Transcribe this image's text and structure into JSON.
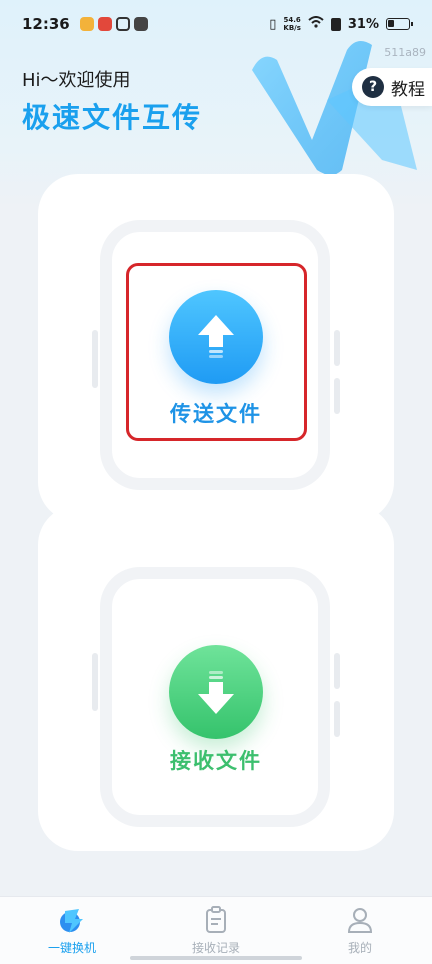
{
  "status_bar": {
    "time": "12:36",
    "net_speed_value": "54.6",
    "net_speed_unit": "KB/s",
    "battery": "31%"
  },
  "version": "511a89",
  "header": {
    "greeting": "Hi～欢迎使用",
    "title": "极速文件互传",
    "tutorial_label": "教程"
  },
  "cards": {
    "send_label": "传送文件",
    "receive_label": "接收文件"
  },
  "bottom_nav": {
    "items": [
      {
        "label": "一键换机",
        "icon": "switch-phone-icon",
        "active": true
      },
      {
        "label": "接收记录",
        "icon": "clipboard-icon",
        "active": false
      },
      {
        "label": "我的",
        "icon": "person-icon",
        "active": false
      }
    ]
  },
  "colors": {
    "accent": "#1aa0ee",
    "send": "#1f9bf4",
    "receive": "#35c36c",
    "highlight": "#d6262a"
  }
}
